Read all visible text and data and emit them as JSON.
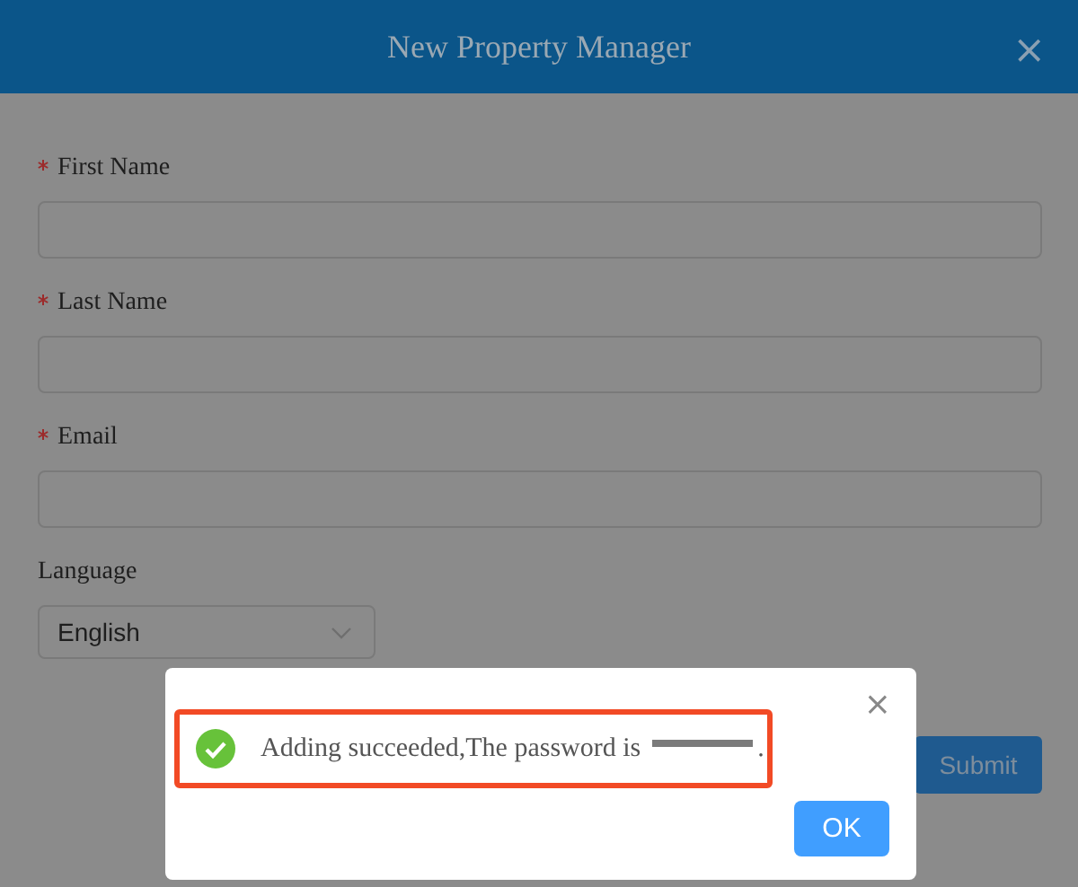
{
  "dialog": {
    "title": "New Property Manager",
    "close": "×"
  },
  "fields": [
    {
      "label": "First Name",
      "required": true,
      "kind": "text"
    },
    {
      "label": "Last Name",
      "required": true,
      "kind": "text"
    },
    {
      "label": "Email",
      "required": true,
      "kind": "text"
    },
    {
      "label": "Language",
      "required": false,
      "kind": "select",
      "value": "English"
    }
  ],
  "submit": "Submit",
  "message_box": {
    "close": "×",
    "text": "Adding succeeded,The password is",
    "text_end": ".",
    "highlighted": true,
    "button": "OK"
  }
}
